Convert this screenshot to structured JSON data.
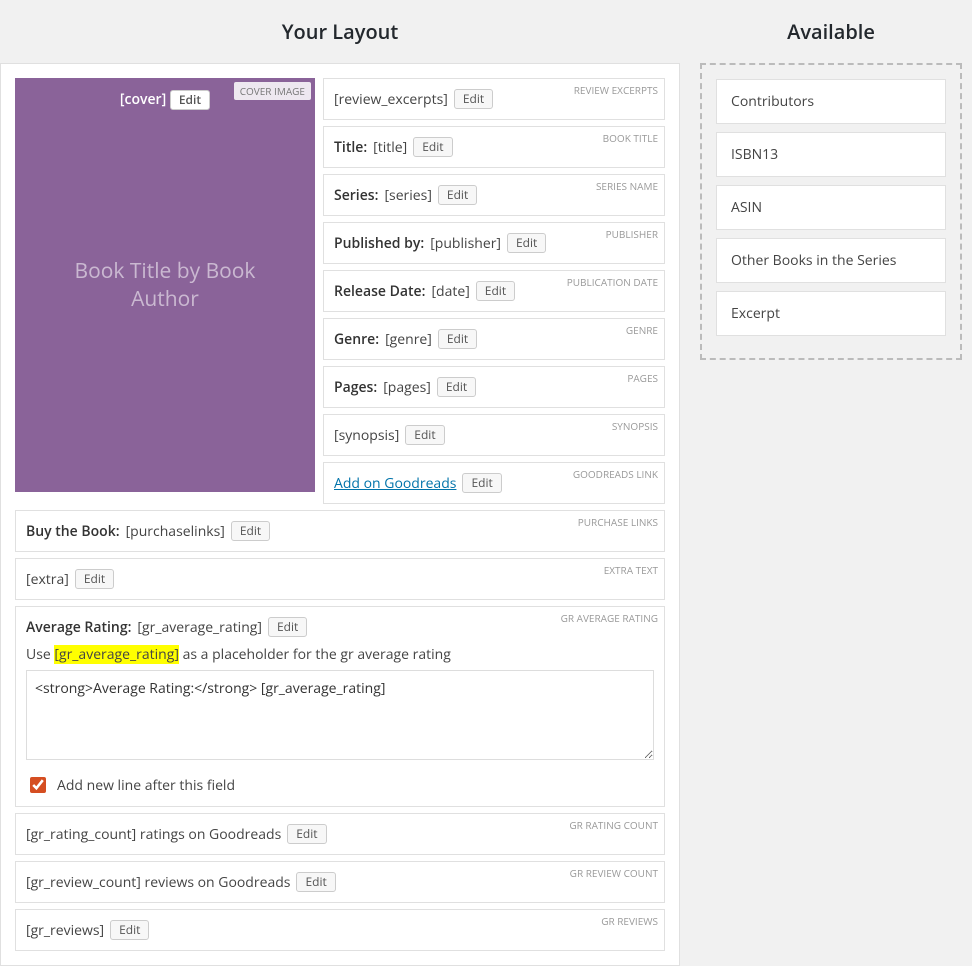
{
  "headings": {
    "left": "Your Layout",
    "right": "Available"
  },
  "edit_label": "Edit",
  "cover": {
    "tag": "COVER IMAGE",
    "placeholder": "[cover]",
    "center_text": "Book Title by Book Author"
  },
  "fields": [
    {
      "id": "review_excerpts",
      "tag": "REVIEW EXCERPTS",
      "parts": [
        {
          "t": "text",
          "v": "[review_excerpts]"
        }
      ]
    },
    {
      "id": "book_title",
      "tag": "BOOK TITLE",
      "parts": [
        {
          "t": "strong",
          "v": "Title:"
        },
        {
          "t": "text",
          "v": "[title]"
        }
      ]
    },
    {
      "id": "series_name",
      "tag": "SERIES NAME",
      "parts": [
        {
          "t": "strong",
          "v": "Series:"
        },
        {
          "t": "text",
          "v": "[series]"
        }
      ]
    },
    {
      "id": "publisher",
      "tag": "PUBLISHER",
      "parts": [
        {
          "t": "strong",
          "v": "Published by:"
        },
        {
          "t": "text",
          "v": "[publisher]"
        }
      ]
    },
    {
      "id": "pub_date",
      "tag": "PUBLICATION DATE",
      "parts": [
        {
          "t": "strong",
          "v": "Release Date:"
        },
        {
          "t": "text",
          "v": "[date]"
        }
      ]
    },
    {
      "id": "genre",
      "tag": "GENRE",
      "parts": [
        {
          "t": "strong",
          "v": "Genre:"
        },
        {
          "t": "text",
          "v": "[genre]"
        }
      ]
    },
    {
      "id": "pages",
      "tag": "PAGES",
      "parts": [
        {
          "t": "strong",
          "v": "Pages:"
        },
        {
          "t": "text",
          "v": "[pages]"
        }
      ]
    },
    {
      "id": "synopsis",
      "tag": "SYNOPSIS",
      "parts": [
        {
          "t": "text",
          "v": "[synopsis]"
        }
      ]
    },
    {
      "id": "goodreads_link",
      "tag": "GOODREADS LINK",
      "parts": [
        {
          "t": "link",
          "v": "Add on Goodreads"
        }
      ]
    }
  ],
  "full_fields": [
    {
      "id": "purchase_links",
      "tag": "PURCHASE LINKS",
      "parts": [
        {
          "t": "strong",
          "v": "Buy the Book:"
        },
        {
          "t": "text",
          "v": "[purchaselinks]"
        }
      ]
    },
    {
      "id": "extra_text",
      "tag": "EXTRA TEXT",
      "parts": [
        {
          "t": "text",
          "v": "[extra]"
        }
      ]
    }
  ],
  "expanded": {
    "id": "gr_average_rating",
    "tag": "GR AVERAGE RATING",
    "parts": [
      {
        "t": "strong",
        "v": "Average Rating:"
      },
      {
        "t": "text",
        "v": "[gr_average_rating]"
      }
    ],
    "hint_pre": "Use ",
    "hint_hl": "[gr_average_rating]",
    "hint_post": " as a placeholder for the gr average rating",
    "textarea_value": "<strong>Average Rating:</strong> [gr_average_rating]",
    "checkbox_checked": true,
    "checkbox_label": "Add new line after this field"
  },
  "tail_fields": [
    {
      "id": "gr_rating_count",
      "tag": "GR RATING COUNT",
      "parts": [
        {
          "t": "text",
          "v": "[gr_rating_count] ratings on Goodreads"
        }
      ]
    },
    {
      "id": "gr_review_count",
      "tag": "GR REVIEW COUNT",
      "parts": [
        {
          "t": "text",
          "v": "[gr_review_count] reviews on Goodreads"
        }
      ]
    },
    {
      "id": "gr_reviews",
      "tag": "GR REVIEWS",
      "parts": [
        {
          "t": "text",
          "v": "[gr_reviews]"
        }
      ]
    }
  ],
  "available": [
    "Contributors",
    "ISBN13",
    "ASIN",
    "Other Books in the Series",
    "Excerpt"
  ]
}
